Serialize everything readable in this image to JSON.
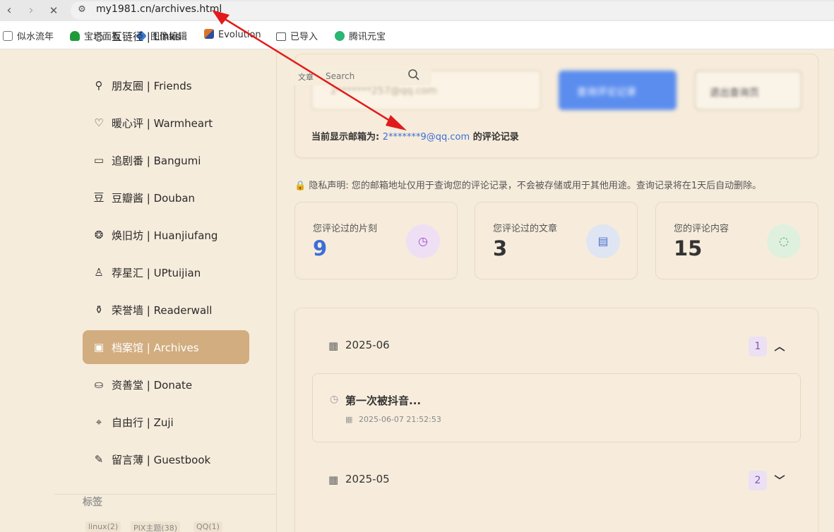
{
  "browser": {
    "url": "my1981.cn/archives.html",
    "nav": {
      "back": "‹",
      "forward": "›",
      "stop": "✕"
    },
    "bookmarks": [
      {
        "label": "似水流年",
        "color": "#777777"
      },
      {
        "label": "宝塔面板",
        "color": "#1e9a3a"
      },
      {
        "label": "图像编辑",
        "color": "#3a7bd5"
      },
      {
        "label": "Evolution",
        "color": "#d9742a"
      },
      {
        "label": "已导入",
        "color": "#555555"
      },
      {
        "label": "腾讯元宝",
        "color": "#2bb673"
      }
    ]
  },
  "sidebar": {
    "partial_item": "互链径 | Links",
    "items": [
      {
        "label": "朋友圈 | Friends",
        "icon": "friends-icon"
      },
      {
        "label": "暖心评 | Warmheart",
        "icon": "heart-icon"
      },
      {
        "label": "追剧番 | Bangumi",
        "icon": "tv-icon"
      },
      {
        "label": "豆瓣酱 | Douban",
        "icon": "douban-icon"
      },
      {
        "label": "焕旧坊 | Huanjiufang",
        "icon": "recycle-icon"
      },
      {
        "label": "荐星汇 | UPtuijian",
        "icon": "user-star-icon"
      },
      {
        "label": "荣誉墙 | Readerwall",
        "icon": "medal-icon"
      },
      {
        "label": "档案馆 | Archives",
        "icon": "archive-icon",
        "active": true
      },
      {
        "label": "资善堂 | Donate",
        "icon": "donate-icon"
      },
      {
        "label": "自由行 | Zuji",
        "icon": "map-icon"
      },
      {
        "label": "留言薄 | Guestbook",
        "icon": "guestbook-icon"
      }
    ],
    "tags_title": "标签",
    "tags": [
      "linux(2)",
      "PIX主题(38)",
      "QQ(1)"
    ]
  },
  "search": {
    "label": "文章",
    "placeholder": "Search"
  },
  "query": {
    "email_placeholder": "2*******257@qq.com",
    "query_button": "查询评论记录",
    "exit_button": "退出查询页",
    "current_prefix": "当前显示邮箱为: ",
    "current_email": "2*******9@qq.com",
    "current_suffix": " 的评论记录"
  },
  "privacy": "隐私声明: 您的邮箱地址仅用于查询您的评论记录，不会被存储或用于其他用途。查询记录将在1天后自动删除。",
  "stats": [
    {
      "label": "您评论过的片刻",
      "value": "9",
      "icon": "clock-icon",
      "color": "#3b6fd8",
      "bg": "#efdff5",
      "icon_color": "#9b4fc6"
    },
    {
      "label": "您评论过的文章",
      "value": "3",
      "icon": "document-icon",
      "color": "#333333",
      "bg": "#dfe5f2",
      "icon_color": "#4a74c9"
    },
    {
      "label": "您的评论内容",
      "value": "15",
      "icon": "chat-icon",
      "color": "#333333",
      "bg": "#dff0df",
      "icon_color": "#3aa25a"
    }
  ],
  "archive": {
    "months": [
      {
        "label": "2025-06",
        "count": "1",
        "expanded": true
      },
      {
        "label": "2025-05",
        "count": "2",
        "expanded": false
      }
    ],
    "post": {
      "title": "第一次被抖音...",
      "date": "2025-06-07 21:52:53"
    }
  }
}
